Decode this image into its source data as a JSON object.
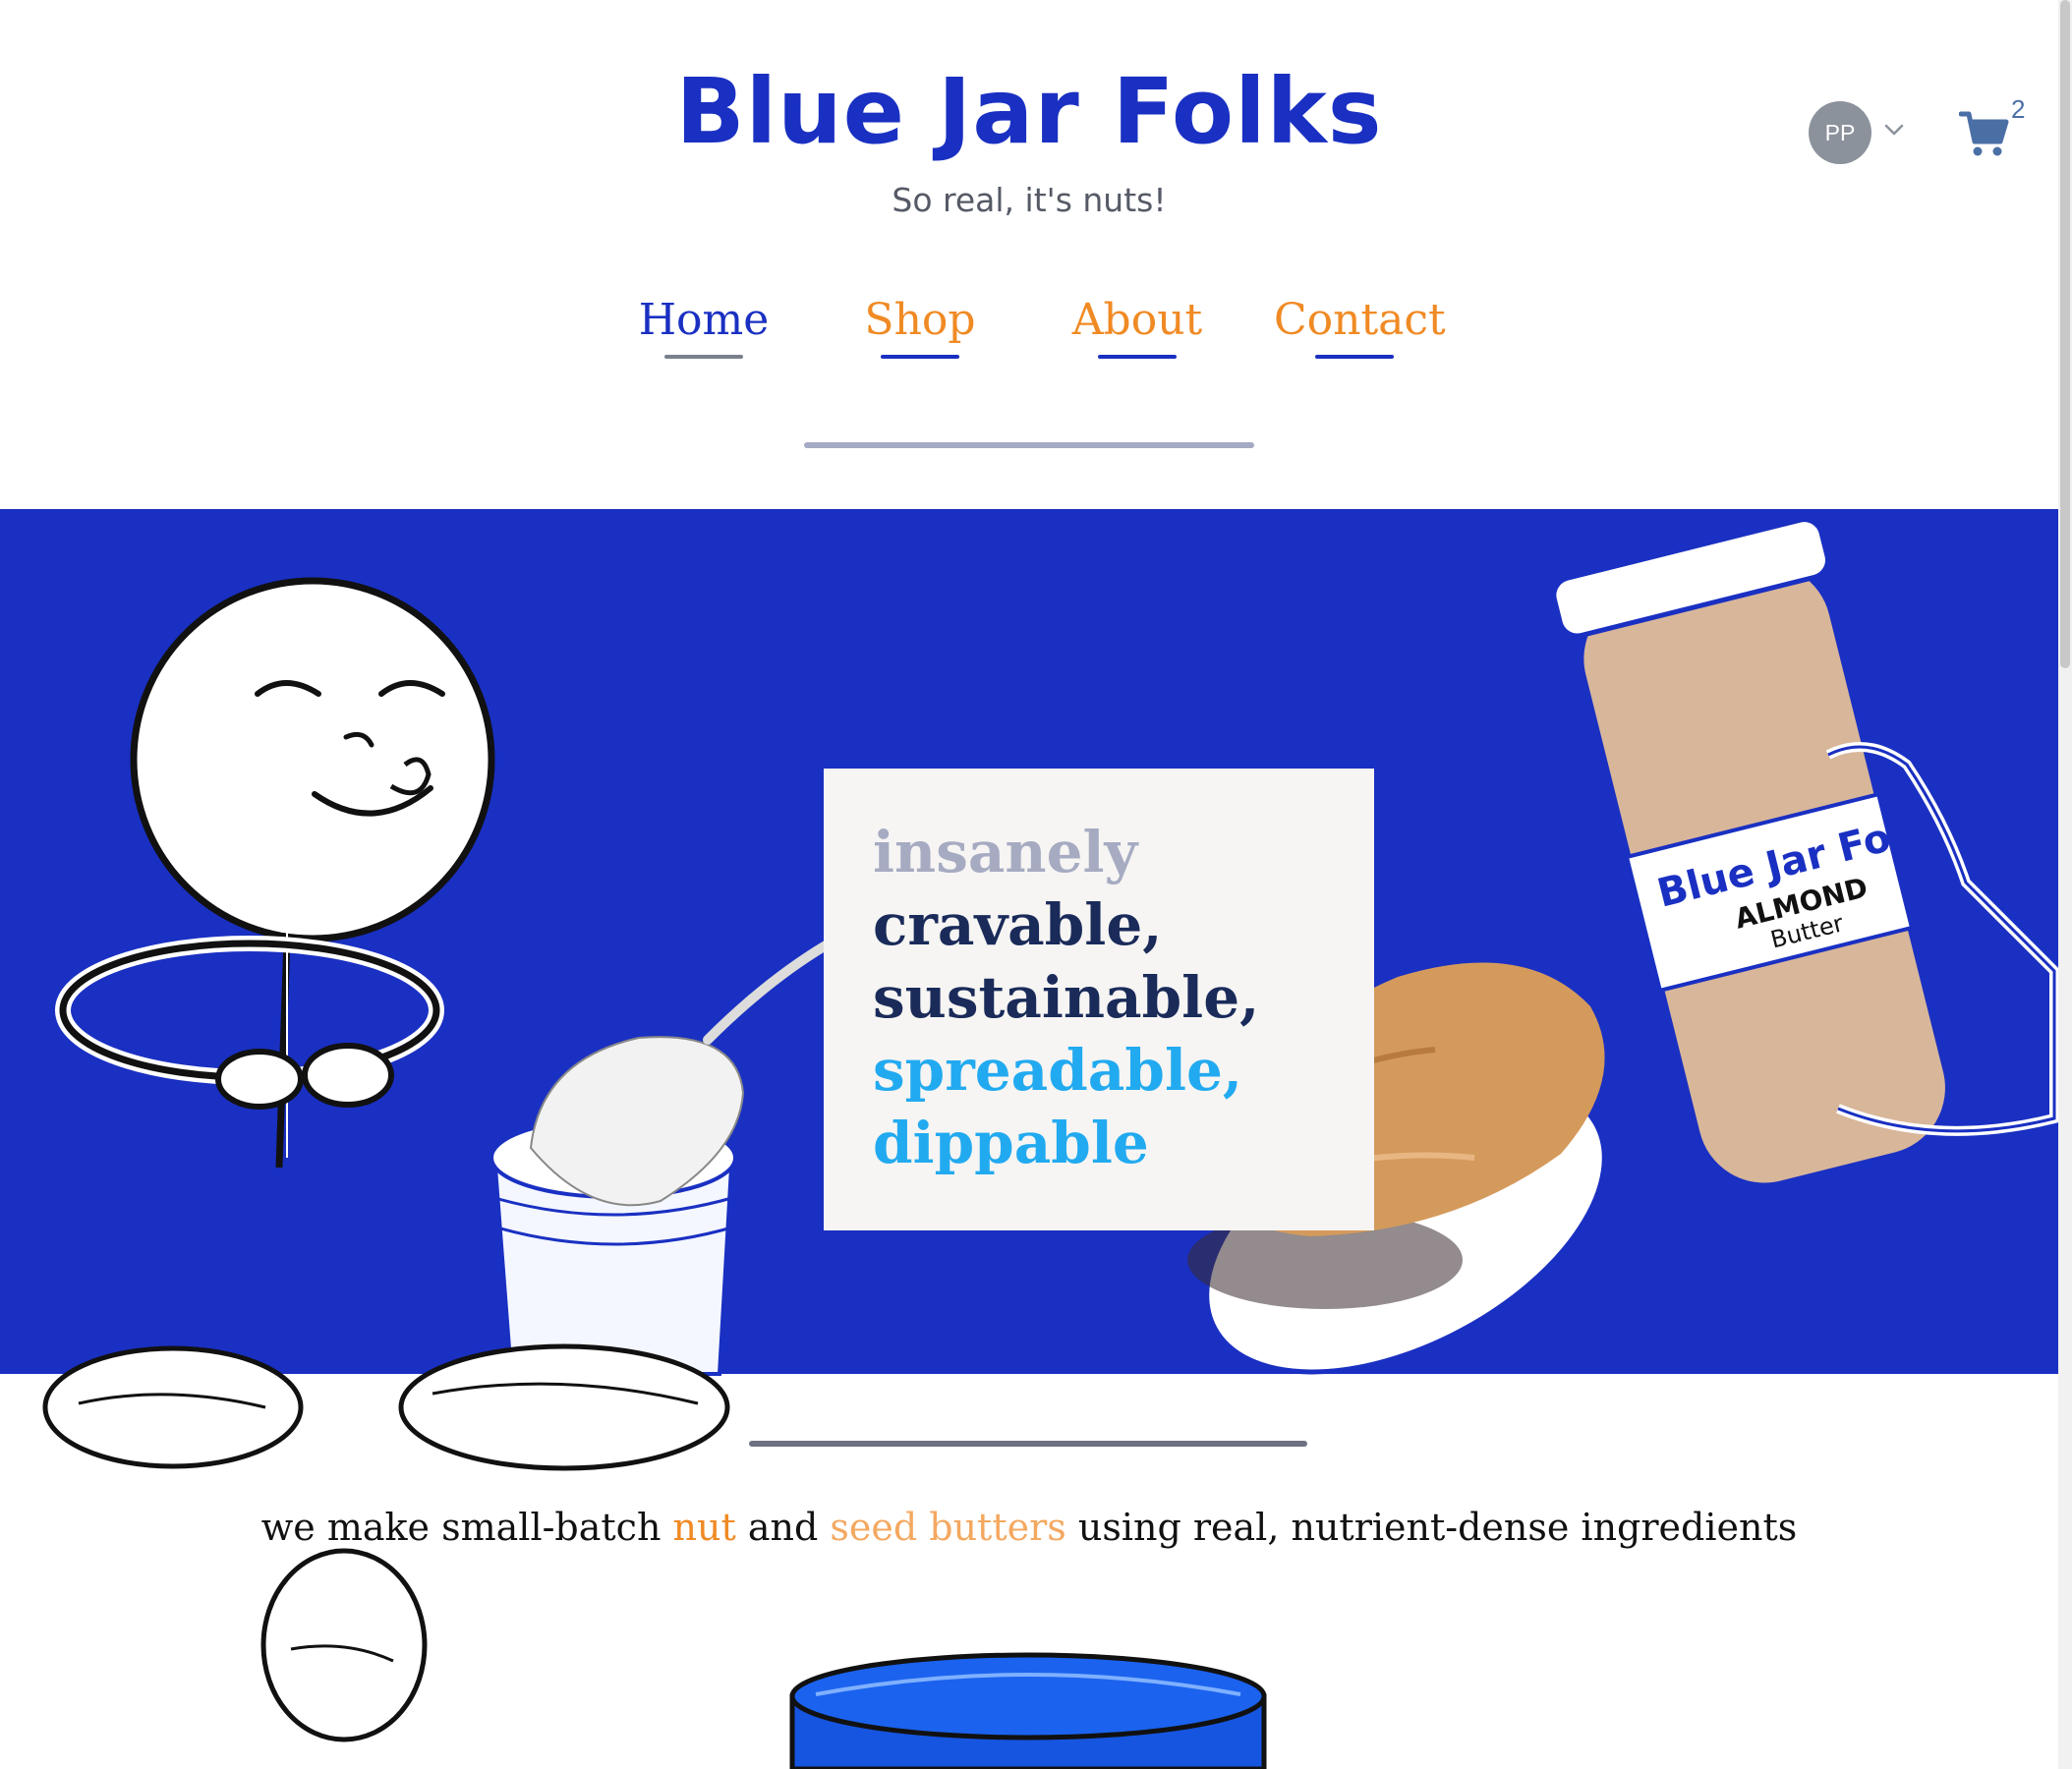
{
  "header": {
    "brand": "Blue Jar Folks",
    "tagline": "So real, it's nuts!",
    "account_initials": "PP",
    "cart_count": "2"
  },
  "nav": {
    "items": [
      {
        "label": "Home",
        "active": true
      },
      {
        "label": "Shop",
        "active": false
      },
      {
        "label": "About",
        "active": false
      },
      {
        "label": "Contact",
        "active": false
      }
    ]
  },
  "hero": {
    "words": [
      "insanely",
      "cravable,",
      "sustainable,",
      "spreadable,",
      "dippable"
    ],
    "jar_label": {
      "brand": "Blue Jar Folks",
      "product": "ALMOND",
      "type": "Butter"
    }
  },
  "mission": {
    "part1": "we make small-batch ",
    "highlight1": "nut",
    "part2": " and ",
    "highlight2": "seed butters",
    "part3": " using real, nutrient-dense ingredients"
  },
  "colors": {
    "brand_blue": "#1a30c2",
    "accent_orange": "#f08a24",
    "accent_peach": "#f4a860",
    "accent_cyan": "#22aaf0",
    "dark_navy": "#1a2b5a"
  }
}
